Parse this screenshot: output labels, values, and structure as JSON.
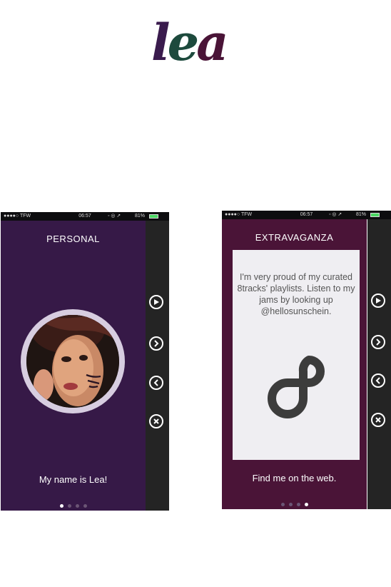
{
  "logo": {
    "letters": [
      "l",
      "e",
      "a"
    ],
    "colors": [
      "#3a1b4d",
      "#1d4a3d",
      "#4a1437"
    ]
  },
  "tagline": {
    "line1": "",
    "line2": ""
  },
  "footer": {
    "text": ""
  },
  "phones": [
    {
      "status": {
        "carrier": "●●●●○ TFW",
        "time": "06:57",
        "battery": "81%"
      },
      "title": "PERSONAL",
      "caption": "My name is Lea!",
      "page_dots": 4,
      "active_dot": 0,
      "accent": "#361947",
      "rail_buttons": [
        "play-icon",
        "forward-icon",
        "back-icon",
        "close-icon"
      ]
    },
    {
      "status": {
        "carrier": "●●●●○ TFW",
        "time": "06:57",
        "battery": "81%"
      },
      "title": "EXTRAVAGANZA",
      "card_text": "I'm very proud of my curated 8tracks' playlists. Listen to my jams by looking up @hellosunschein.",
      "caption": "Find me on the web.",
      "page_dots": 4,
      "active_dot": 3,
      "accent": "#4a1437",
      "rail_buttons": [
        "play-icon",
        "forward-icon",
        "back-icon",
        "close-icon"
      ]
    }
  ]
}
